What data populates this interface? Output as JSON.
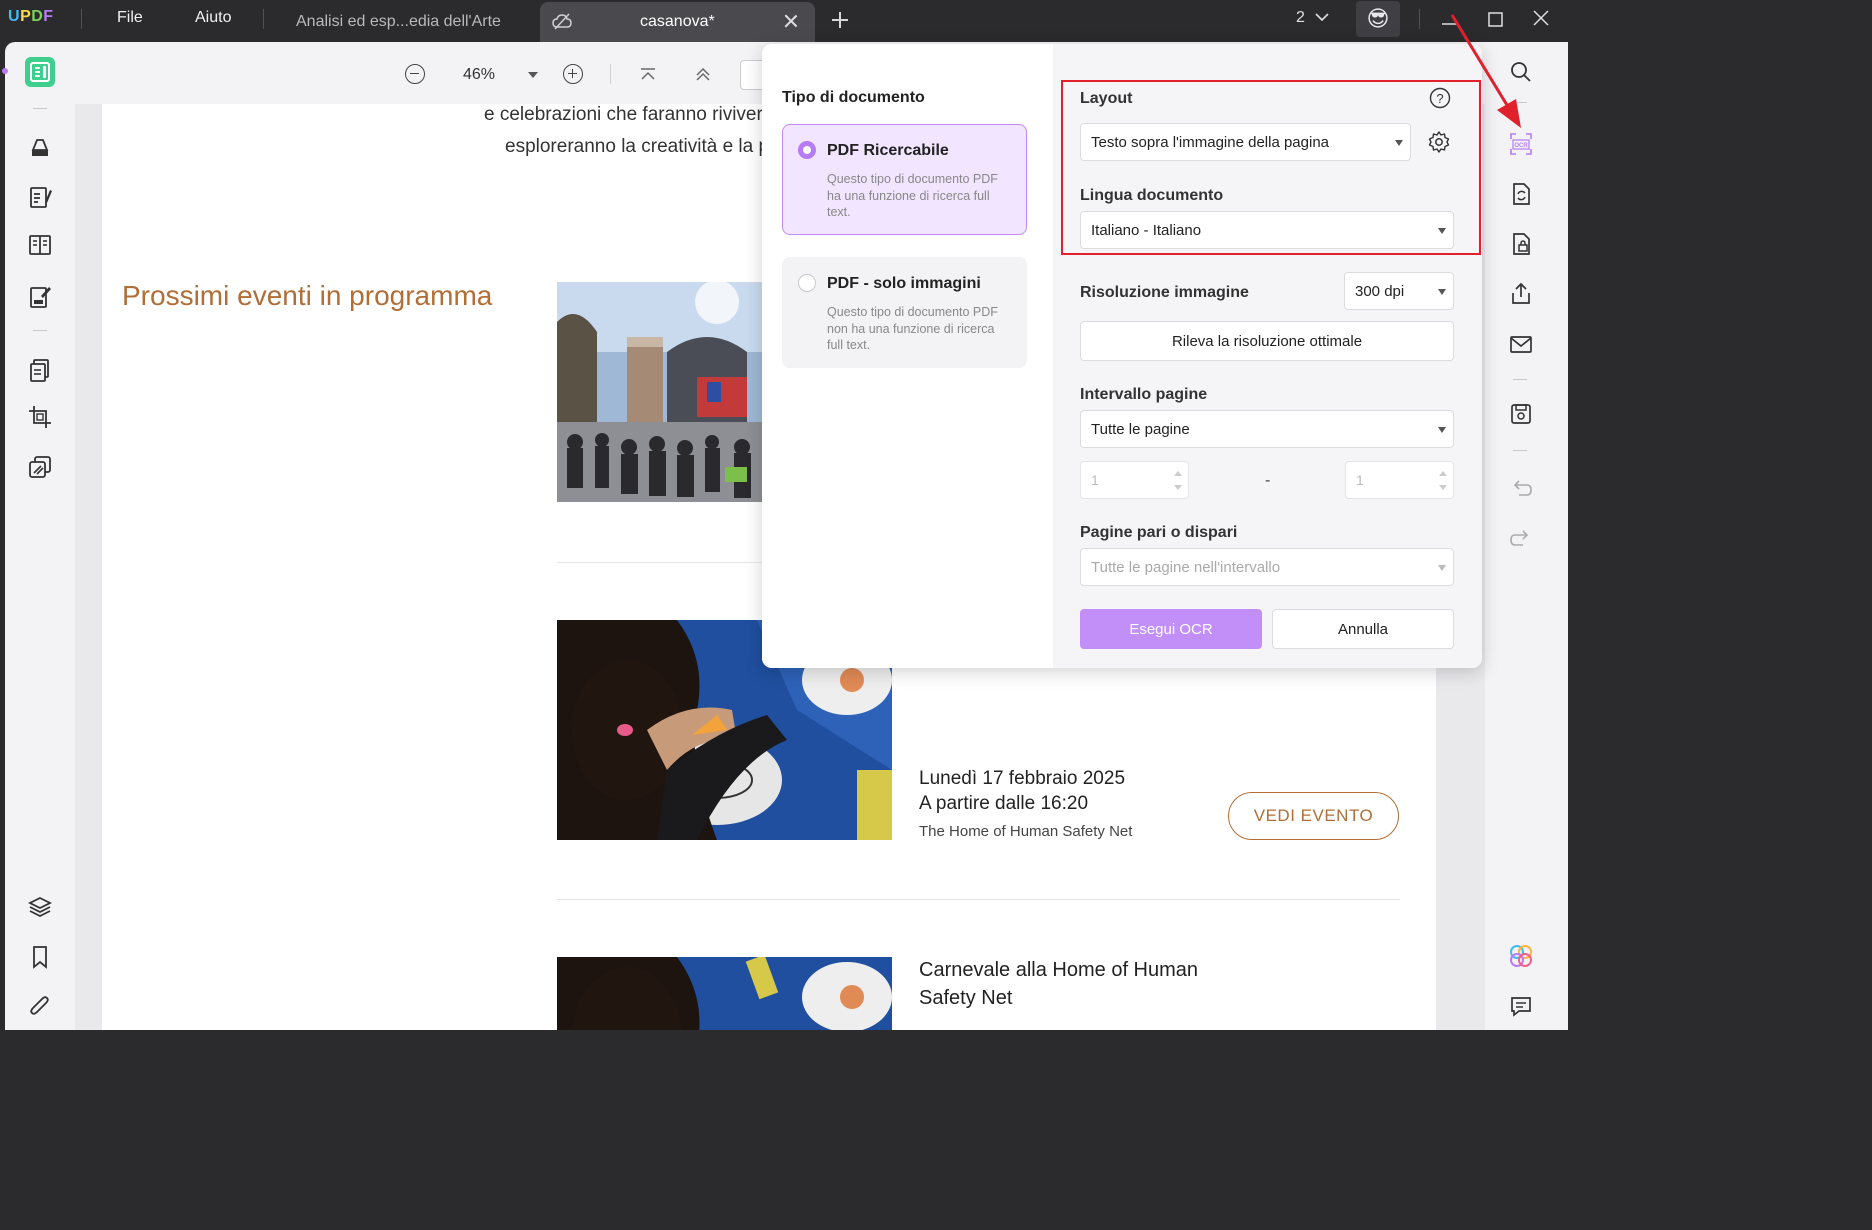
{
  "app": {
    "logo": "UPDF",
    "menu": [
      "File",
      "Aiuto"
    ],
    "tabs": [
      {
        "label": "Analisi ed esp...edia dell'Arte",
        "active": false
      },
      {
        "label": "casanova*",
        "active": true
      }
    ],
    "window_count": "2",
    "avatar_emoji": "😎"
  },
  "toolbar": {
    "zoom": "46%"
  },
  "document": {
    "intro_line1": "e celebrazioni che faranno rivivere",
    "intro_line2": "esploreranno la creatività e la pa",
    "events_heading": "Prossimi eventi in programma",
    "event1": {
      "date": "Lunedì 17 febbraio 2025",
      "time": "A partire dalle 16:20",
      "venue": "The Home of Human Safety Net",
      "button": "VEDI EVENTO"
    },
    "event2": {
      "title_line1": "Carnevale alla Home of Human",
      "title_line2": "Safety Net"
    }
  },
  "ocr": {
    "doc_type_title": "Tipo di documento",
    "options": [
      {
        "title": "PDF Ricercabile",
        "desc": "Questo tipo di documento PDF ha una funzione di ricerca full text.",
        "selected": true
      },
      {
        "title": "PDF - solo immagini",
        "desc": "Questo tipo di documento PDF non ha una funzione di ricerca full text.",
        "selected": false
      }
    ],
    "layout_label": "Layout",
    "layout_value": "Testo sopra l'immagine della pagina",
    "language_label": "Lingua documento",
    "language_value": "Italiano - Italiano",
    "resolution_label": "Risoluzione immagine",
    "resolution_value": "300 dpi",
    "detect_button": "Rileva la risoluzione ottimale",
    "range_label": "Intervallo pagine",
    "range_value": "Tutte le pagine",
    "range_from": "1",
    "range_to": "1",
    "range_dash": "-",
    "parity_label": "Pagine pari o dispari",
    "parity_value": "Tutte le pagine nell'intervallo",
    "run_button": "Esegui OCR",
    "cancel_button": "Annulla"
  },
  "colors": {
    "accent": "#b67bf6",
    "heading_brown": "#b06e38",
    "annotation_red": "#e0202a"
  }
}
